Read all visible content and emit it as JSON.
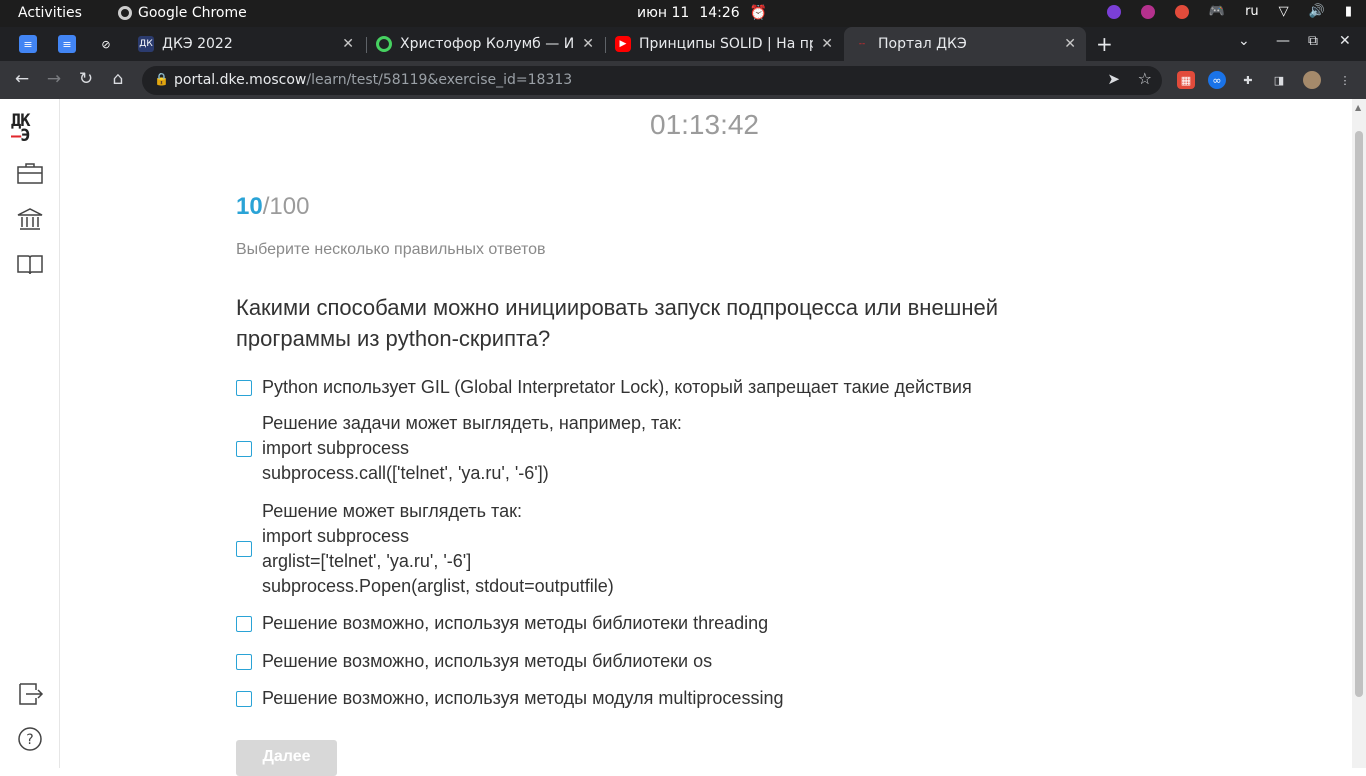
{
  "os": {
    "activities": "Activities",
    "app_name": "Google Chrome",
    "date": "июн 11",
    "time": "14:26",
    "lang": "ru"
  },
  "tabs": [
    {
      "title": "ДКЭ 2022",
      "favicon": "ДКЭ"
    },
    {
      "title": "Христофор Колумб — Ис",
      "favicon": "circle"
    },
    {
      "title": "Принципы SOLID | На пр",
      "favicon": "youtube"
    },
    {
      "title": "Портал ДКЭ",
      "favicon": "dke"
    }
  ],
  "address": {
    "host": "portal.dke.moscow",
    "path": "/learn/test/58119&exercise_id=18313"
  },
  "logo": {
    "top": "ДК",
    "bottom": "Э",
    "dash": "—"
  },
  "quiz": {
    "timer": "01:13:42",
    "current": "10",
    "total": "/100",
    "hint": "Выберите несколько правильных ответов",
    "question": "Какими способами можно инициировать запуск подпроцесса или внешней программы из python-скрипта?",
    "options": [
      {
        "lines": [
          "Python использует GIL (Global Interpretator Lock), который запрещает такие действия"
        ]
      },
      {
        "lines": [
          "Решение задачи может выглядеть, например, так:",
          "import subprocess",
          "subprocess.call(['telnet', 'ya.ru', '-6'])"
        ]
      },
      {
        "lines": [
          "Решение может выглядеть так:",
          "import subprocess",
          "arglist=['telnet', 'ya.ru', '-6']",
          "subprocess.Popen(arglist, stdout=outputfile)"
        ]
      },
      {
        "lines": [
          "Решение возможно, используя методы библиотеки threading"
        ]
      },
      {
        "lines": [
          "Решение возможно, используя методы библиотеки os"
        ]
      },
      {
        "lines": [
          "Решение возможно, используя методы модуля multiprocessing"
        ]
      }
    ],
    "next_label": "Далее"
  },
  "colors": {
    "accent": "#2aa3d6",
    "logo_red": "#e1272d",
    "muted": "#9b9b9b"
  }
}
